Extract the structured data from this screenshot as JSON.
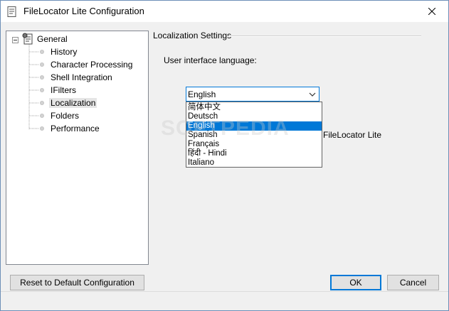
{
  "window": {
    "title": "FileLocator Lite Configuration"
  },
  "tree": {
    "root_label": "General",
    "items": [
      {
        "label": "History",
        "selected": false
      },
      {
        "label": "Character Processing",
        "selected": false
      },
      {
        "label": "Shell Integration",
        "selected": false
      },
      {
        "label": "IFilters",
        "selected": false
      },
      {
        "label": "Localization",
        "selected": true
      },
      {
        "label": "Folders",
        "selected": false
      },
      {
        "label": "Performance",
        "selected": false
      }
    ]
  },
  "localization": {
    "section_title": "Localization Settings",
    "language_label": "User interface language:",
    "selected_language": "English",
    "options": [
      "简体中文",
      "Deutsch",
      "English",
      "Spanish",
      "Français",
      "हिंदी - Hindi",
      "Italiano"
    ],
    "selected_index": 2,
    "obscured_text": "FileLocator Lite"
  },
  "watermark": "SOFTPEDIA",
  "buttons": {
    "reset": "Reset to Default Configuration",
    "ok": "OK",
    "cancel": "Cancel"
  },
  "colors": {
    "accent": "#0078d7",
    "window_bg": "#f0f0f0",
    "selection_bg": "#e5e5e5"
  }
}
